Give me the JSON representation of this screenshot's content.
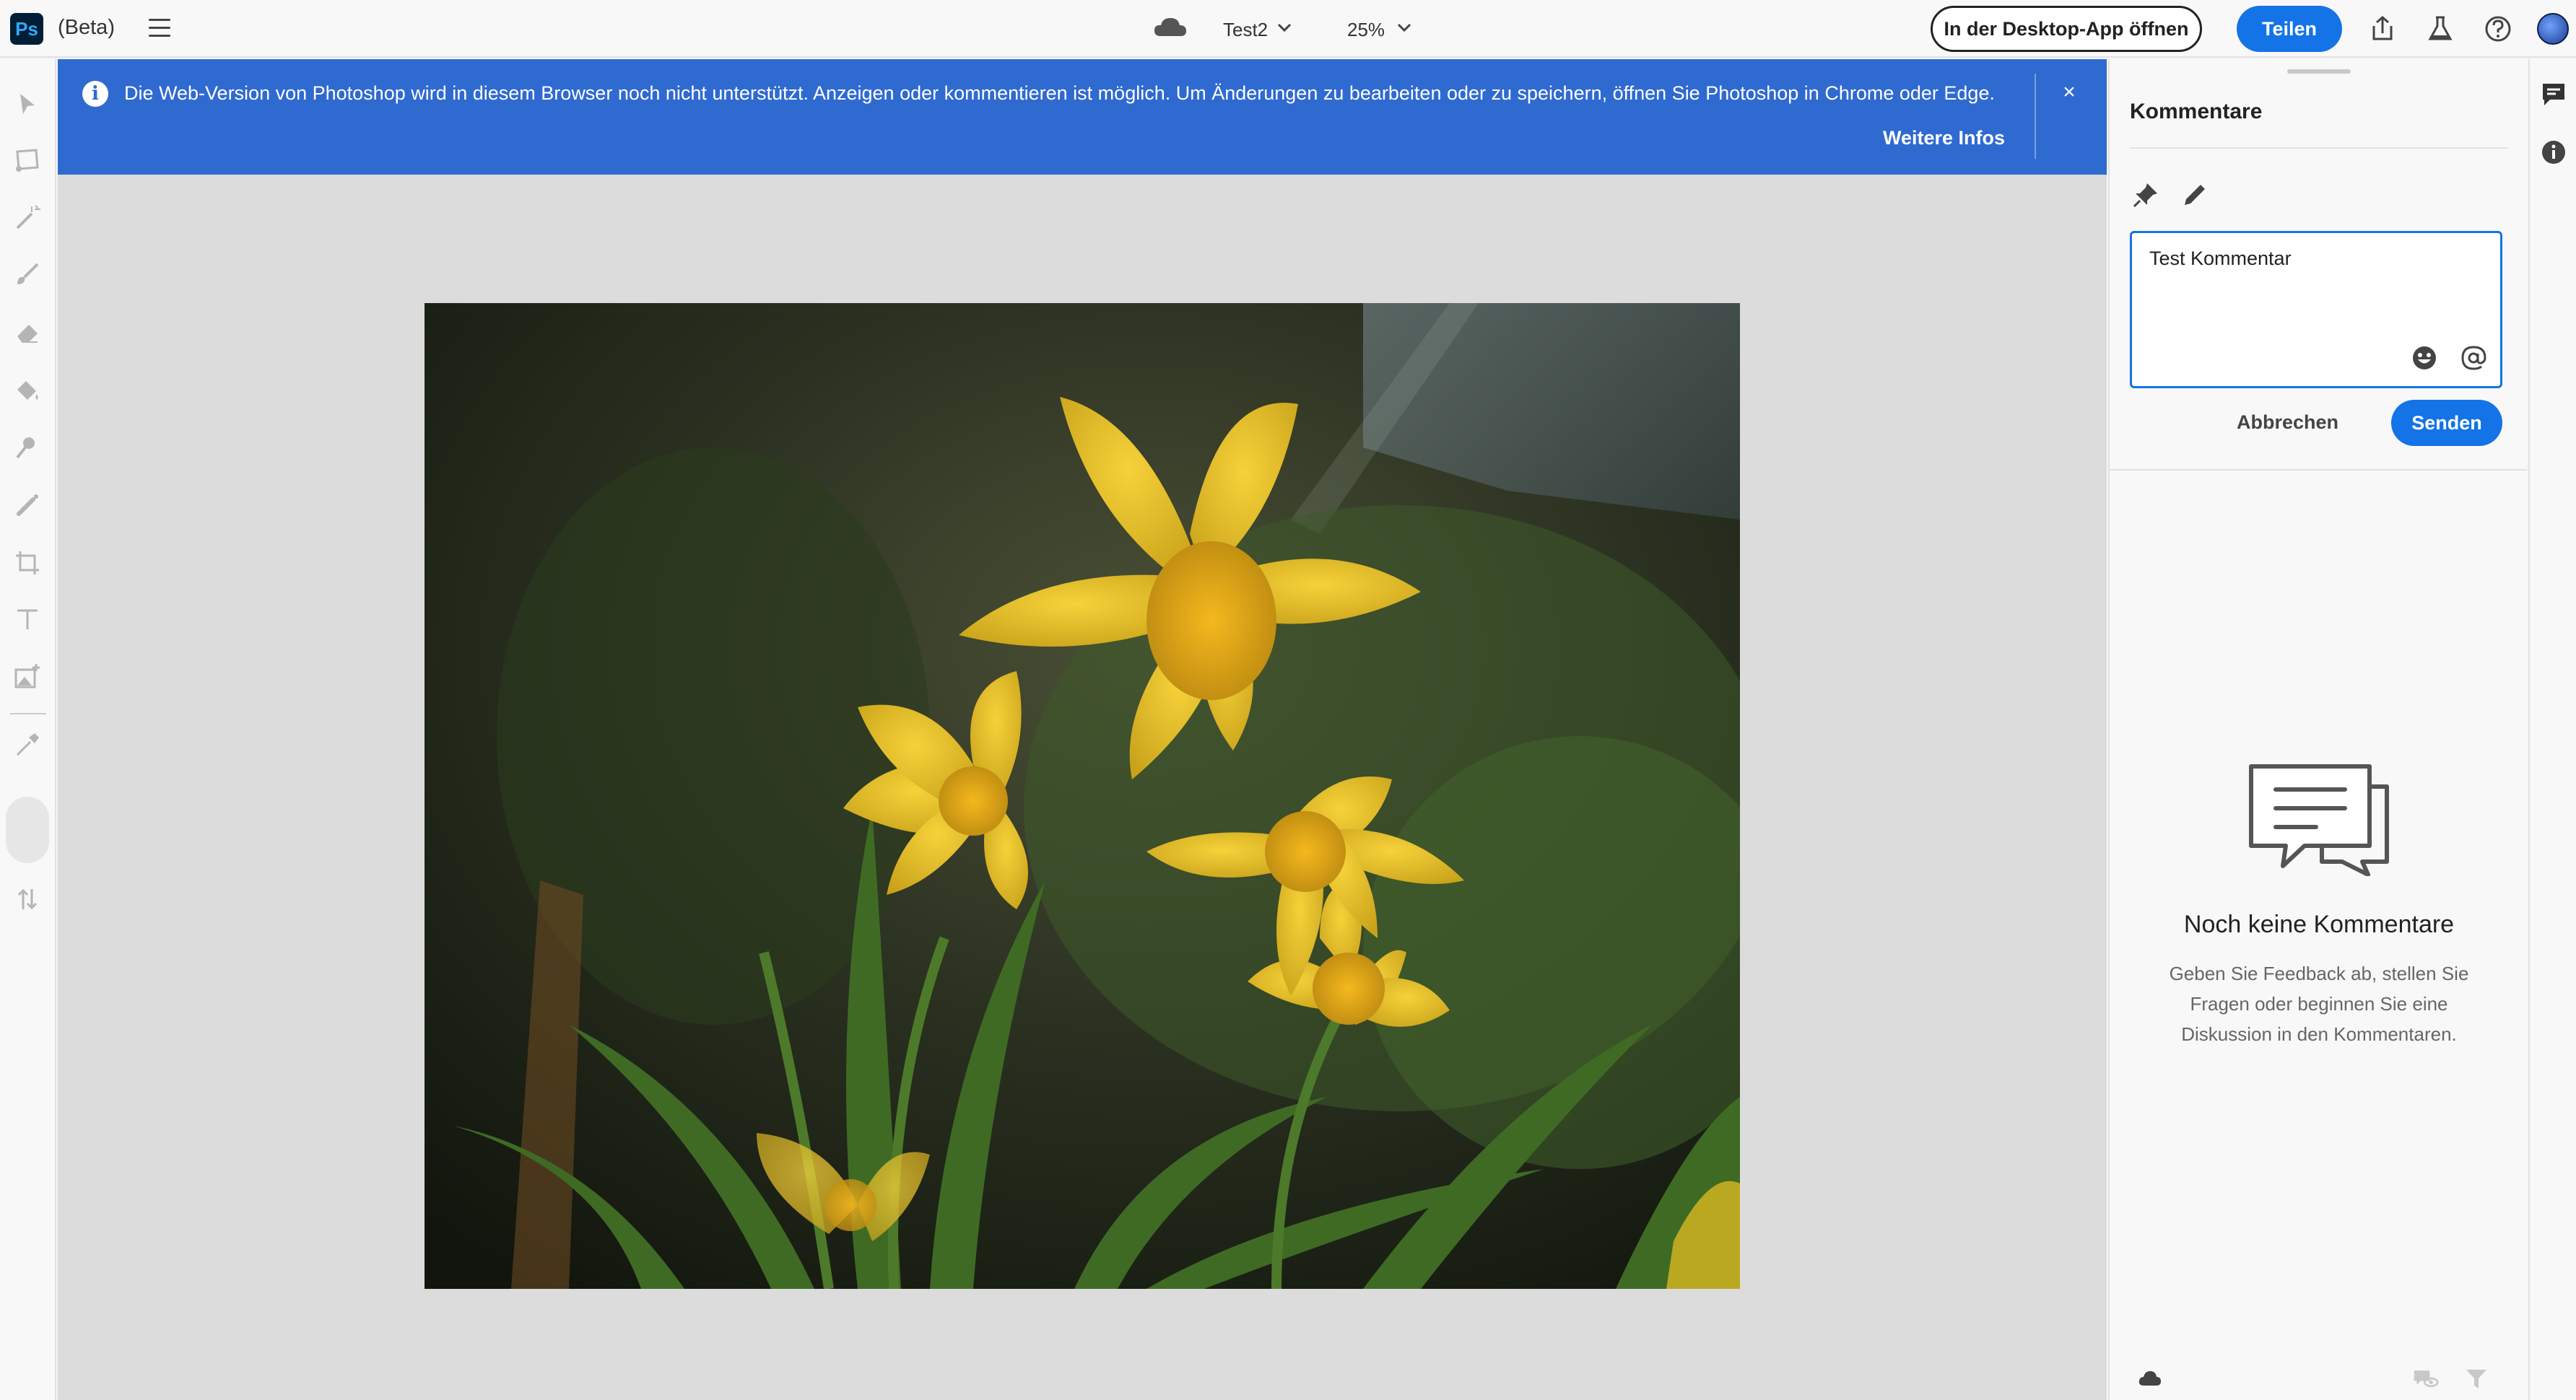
{
  "app": {
    "logo_text": "Ps",
    "beta_label": "(Beta)",
    "document_title": "Test2",
    "zoom_level": "25%"
  },
  "header": {
    "open_desktop_label": "In der Desktop-App öffnen",
    "share_label": "Teilen",
    "icons": [
      "export-icon",
      "beaker-icon",
      "help-icon"
    ]
  },
  "banner": {
    "message": "Die Web-Version von Photoshop wird in diesem Browser noch nicht unterstützt. Anzeigen oder kommentieren ist möglich. Um Änderungen zu bearbeiten oder zu speichern, öffnen Sie Photoshop in Chrome oder Edge.",
    "link_label": "Weitere Infos",
    "close_symbol": "×",
    "info_symbol": "i",
    "color": "#2f6ad0"
  },
  "tools": [
    "select-icon",
    "lasso-icon",
    "quick-select-icon",
    "brush-icon",
    "eraser-icon",
    "paint-bucket-icon",
    "clone-stamp-icon",
    "healing-icon",
    "crop-icon",
    "type-icon",
    "add-image-icon",
    "eyedropper-icon",
    "swap-colors-icon"
  ],
  "comments_panel": {
    "title": "Kommentare",
    "draft_text": "Test Kommentar",
    "cancel_label": "Abbrechen",
    "send_label": "Senden",
    "empty_title": "Noch keine Kommentare",
    "empty_description": "Geben Sie Feedback ab, stellen Sie Fragen oder beginnen Sie eine Diskussion in den Kommentaren."
  },
  "colors": {
    "accent": "#1473e6",
    "canvas_bg": "#dcdcdc",
    "panel_bg": "#f8f8f8"
  }
}
